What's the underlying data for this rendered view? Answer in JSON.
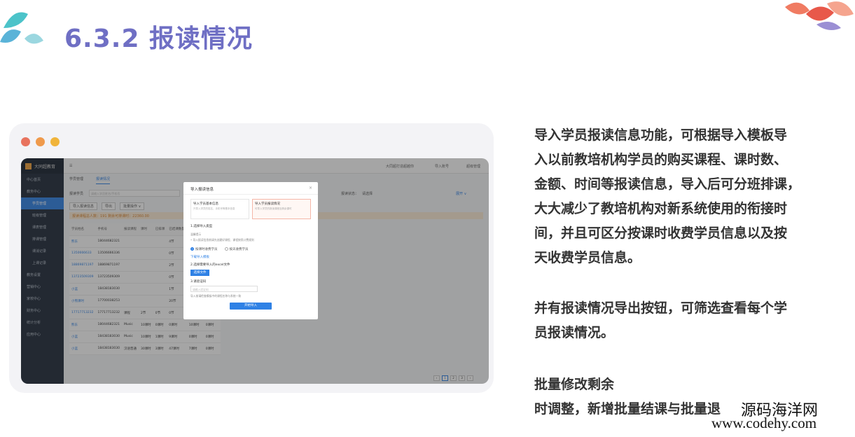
{
  "slide": {
    "title": "6.3.2 报读情况"
  },
  "colors": {
    "accent": "#2f81e5",
    "title": "#6f6fc4",
    "dot_red": "#e8735e",
    "dot_orange": "#ef9a4c",
    "dot_yellow": "#f0b43a",
    "sidebar": "#1f2a3a"
  },
  "window": {
    "dots": [
      "red",
      "orange",
      "yellow"
    ]
  },
  "app": {
    "logo": "大同超教育",
    "top_items": [
      "大同超打造超越你",
      "导入账号",
      "超级管理"
    ],
    "sidebar": [
      {
        "label": "中心首页",
        "sub": false,
        "active": false
      },
      {
        "label": "教务中心",
        "sub": false,
        "active": false
      },
      {
        "label": "学员管理",
        "sub": true,
        "active": true
      },
      {
        "label": "班级管理",
        "sub": true,
        "active": false
      },
      {
        "label": "课表管理",
        "sub": true,
        "active": false
      },
      {
        "label": "排课管理",
        "sub": true,
        "active": false
      },
      {
        "label": "课消记录",
        "sub": true,
        "active": false
      },
      {
        "label": "上课记录",
        "sub": true,
        "active": false
      },
      {
        "label": "教务设置",
        "sub": false,
        "active": false
      },
      {
        "label": "营销中心",
        "sub": false,
        "active": false
      },
      {
        "label": "家校中心",
        "sub": false,
        "active": false
      },
      {
        "label": "财务中心",
        "sub": false,
        "active": false
      },
      {
        "label": "统计分析",
        "sub": false,
        "active": false
      },
      {
        "label": "应用中心",
        "sub": false,
        "active": false
      }
    ],
    "tabs": [
      "学员管理",
      "报读情况"
    ],
    "filter_label": "报读学员",
    "search_placeholder": "请输入学员姓名/手机号",
    "status_label": "报读状态：",
    "status_value": "请选择",
    "expand_label": "展开 ∨",
    "buttons": [
      "导入报读信息",
      "导出",
      "批量操作 ∨"
    ],
    "notice": "报读课程总人数：191   剩余可排课时：22360.00",
    "table_headers": [
      "学员姓名",
      "手机号",
      "报读课程",
      "课时",
      "已排课",
      "已结课数量",
      "退课数量",
      "剩余数量"
    ],
    "table_rows": [
      [
        "熊东",
        "18044682321",
        "",
        "",
        "",
        "4节",
        "0节",
        "0节"
      ],
      [
        "1350666633",
        "13506666336",
        "",
        "",
        "",
        "0节",
        "0节",
        "0节"
      ],
      [
        "18869871197",
        "18869871197",
        "",
        "",
        "",
        "2节",
        "0节",
        "0节"
      ],
      [
        "13723509309",
        "13723509309",
        "",
        "",
        "",
        "0节",
        "0节",
        "0节"
      ],
      [
        "小蓝",
        "18438183030",
        "",
        "",
        "",
        "1节",
        "0节",
        "0节"
      ],
      [
        "小熊课时",
        "17700038253",
        "",
        "",
        "",
        "20节",
        "0节",
        "0节"
      ],
      [
        "17717713232",
        "17717713232",
        "课程",
        "2节",
        "0节",
        "0节",
        "0节",
        "0节"
      ],
      [
        "熊东",
        "18044682321",
        "Music",
        "10课时",
        "0课时",
        "0课时",
        "10课时",
        "0课时"
      ],
      [
        "小蓝",
        "18438183030",
        "Music",
        "10课时",
        "1课时",
        "9课时",
        "0课时",
        "0课时"
      ],
      [
        "小蓝",
        "18438183030",
        "汉语普通",
        "30课时",
        "3课时",
        "47课时",
        "7课时",
        "0课时"
      ]
    ],
    "pager": [
      "‹",
      "1",
      "2",
      "3",
      "›"
    ]
  },
  "dialog": {
    "title": "导入报读信息",
    "close": "×",
    "option1_title": "导入学员基本信息",
    "option1_desc": "只导入学员的姓名、手机号等基本信息",
    "option2_title": "导入学员报读情况",
    "option2_desc": "可导入学员的报读课程及剩余课时",
    "step1": "1.选择导入类型",
    "note_title": "温馨提示",
    "note_text": "• 导入报读信息前请先创建好课程、课程按类计费规则",
    "radio1": "按课时收费学员",
    "radio2": "按天收费学员",
    "template_link": "下载导入模板",
    "step2": "2.选择需要导入的excel文件",
    "upload_label": "选择文件",
    "step3": "3.请验证码",
    "input_placeholder": "请输入验证码",
    "hint": "导入前请检查模板中的课程名称与系统一致",
    "import_label": "开始导入"
  },
  "description": {
    "para1": [
      "导入学员报读信息功能，可根据导入模板导",
      "入以前教培机构学员的购买课程、课时数、",
      "金额、时间等报读信息，导入后可分班排课，",
      "大大减少了教培机构对新系统使用的衔接时",
      "间，并且可区分按课时收费学员信息以及按",
      "天收费学员信息。"
    ],
    "para2": [
      "并有报读情况导出按钮，可筛选查看每个学",
      "员报读情况。"
    ],
    "para3_line1": "批量修改剩余",
    "para3_line2": "时调整，新增批量结课与批量退"
  },
  "watermark": {
    "cn": "源码海洋网",
    "url": "www.codehy.com"
  }
}
